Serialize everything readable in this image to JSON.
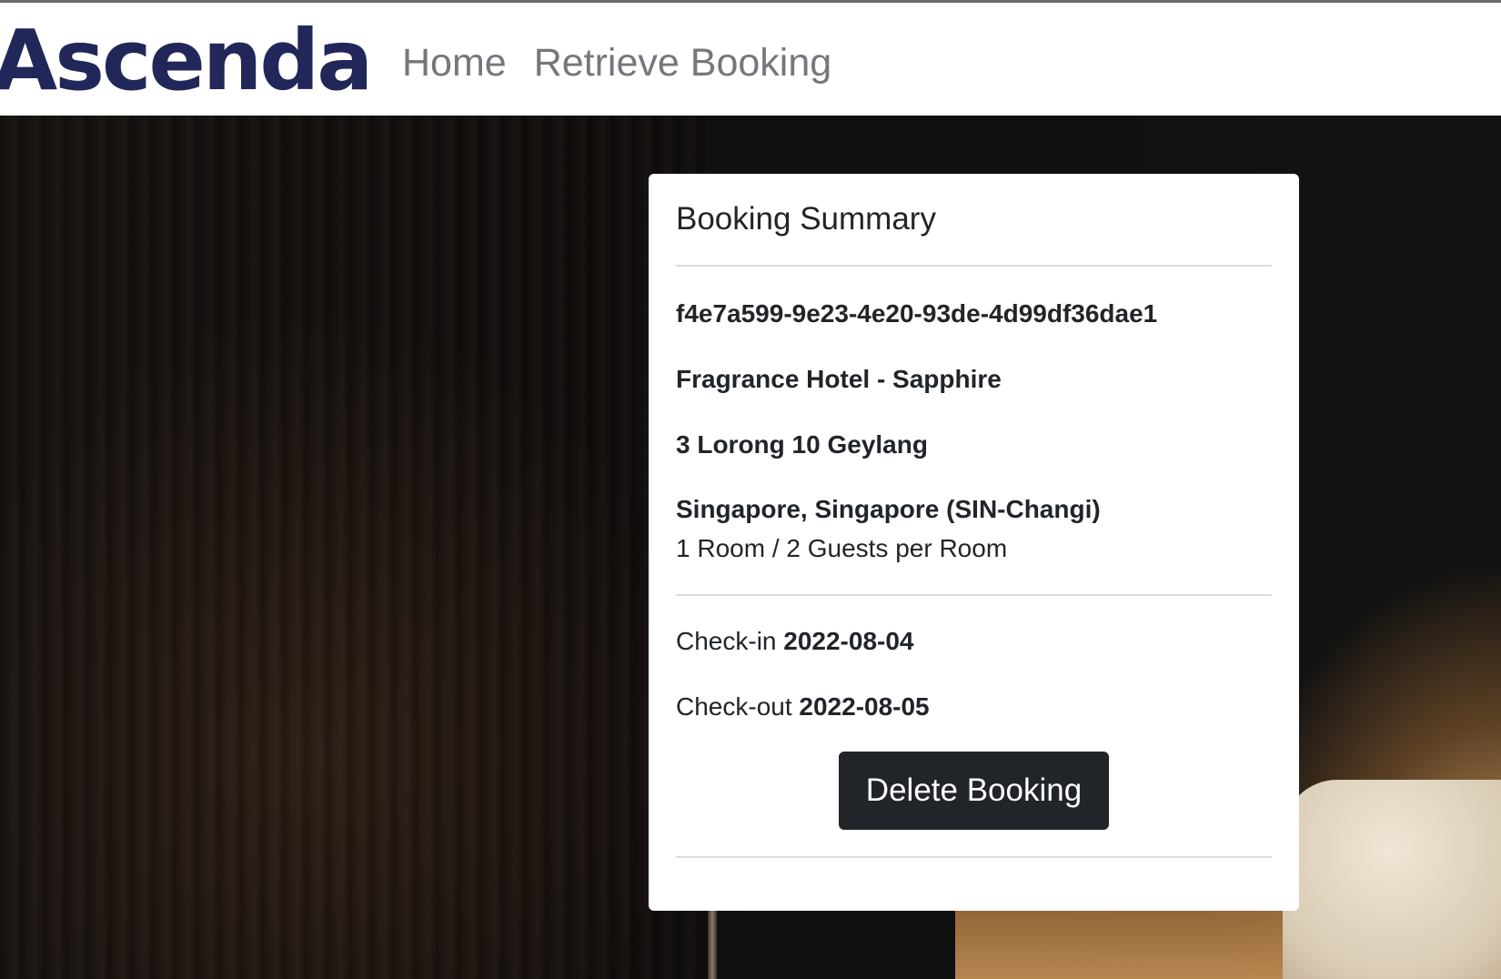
{
  "header": {
    "logo_text": "Ascenda",
    "nav": {
      "home": "Home",
      "retrieve_booking": "Retrieve Booking"
    }
  },
  "booking_summary": {
    "title": "Booking Summary",
    "booking_id": "f4e7a599-9e23-4e20-93de-4d99df36dae1",
    "hotel_name": "Fragrance Hotel - Sapphire",
    "address": "3 Lorong 10 Geylang",
    "destination": "Singapore, Singapore (SIN-Changi)",
    "rooms_guests": "1 Room / 2 Guests per Room",
    "check_in_label": "Check-in",
    "check_in_date": "2022-08-04",
    "check_out_label": "Check-out",
    "check_out_date": "2022-08-05",
    "delete_button_label": "Delete Booking"
  }
}
